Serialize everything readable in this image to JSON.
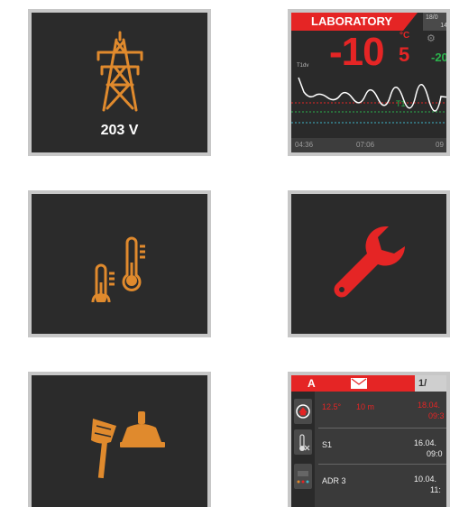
{
  "tiles": {
    "power": {
      "label": "203 V",
      "icon": "power-tower-icon",
      "color": "#e08a2d"
    },
    "laboratory": {
      "banner": "LABORATORY",
      "date_line1": "18/0",
      "date_line2": "14",
      "temperature": "-10",
      "temperature_decimal": "5",
      "unit": "°C",
      "secondary_value": "-20",
      "axis_label": "T1dv",
      "series_label": "T1",
      "times": [
        "04:36",
        "07:06",
        "09"
      ],
      "colors": {
        "accent": "#e52525",
        "green": "#2bb24c",
        "cyan": "#3fb6c9"
      }
    },
    "thermometers": {
      "icon": "thermometers-icon"
    },
    "service": {
      "icon": "wrench-icon",
      "color": "#e52525"
    },
    "cleaning": {
      "icon": "broom-and-dustpan-icon"
    },
    "alarms": {
      "tab_letter": "A",
      "page": "1/",
      "rows": [
        {
          "c1": "12.5°",
          "c2": "10 m",
          "c3": "18.04.",
          "c4": "09:3"
        },
        {
          "c1": "S1",
          "c2": "",
          "c3": "16.04.",
          "c4": "09:0"
        },
        {
          "c1": "ADR 3",
          "c2": "",
          "c3": "10.04.",
          "c4": "11:"
        }
      ]
    }
  }
}
